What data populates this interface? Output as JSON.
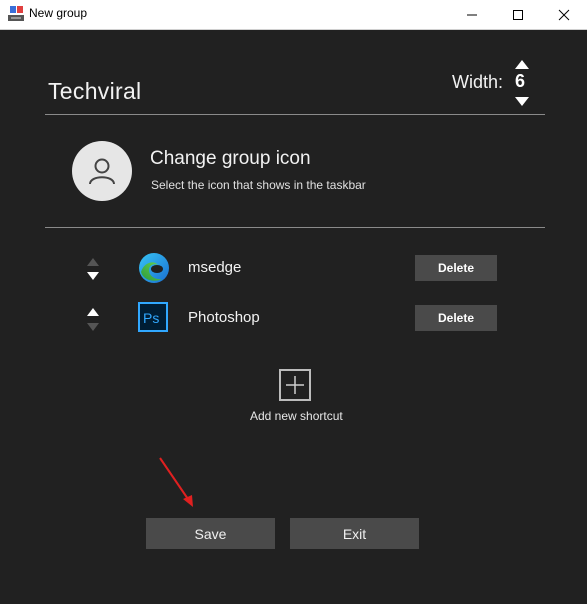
{
  "window": {
    "title": "New group",
    "controls": [
      "minimize-icon",
      "maximize-icon",
      "close-icon"
    ]
  },
  "group": {
    "name": "Techviral",
    "width_label": "Width:",
    "width_value": "6"
  },
  "group_icon": {
    "title": "Change group icon",
    "subtitle": "Select the icon that shows in the taskbar",
    "icon": "user-icon"
  },
  "shortcuts": [
    {
      "name": "msedge",
      "icon": "edge-icon",
      "delete_label": "Delete"
    },
    {
      "name": "Photoshop",
      "icon": "photoshop-icon",
      "delete_label": "Delete"
    }
  ],
  "add_shortcut": {
    "label": "Add new shortcut",
    "icon": "plus-icon"
  },
  "footer": {
    "save_label": "Save",
    "exit_label": "Exit"
  },
  "colors": {
    "background": "#212121",
    "button": "#4a4a4a",
    "text": "#f2f2f2",
    "annotation_arrow": "#e02020"
  }
}
